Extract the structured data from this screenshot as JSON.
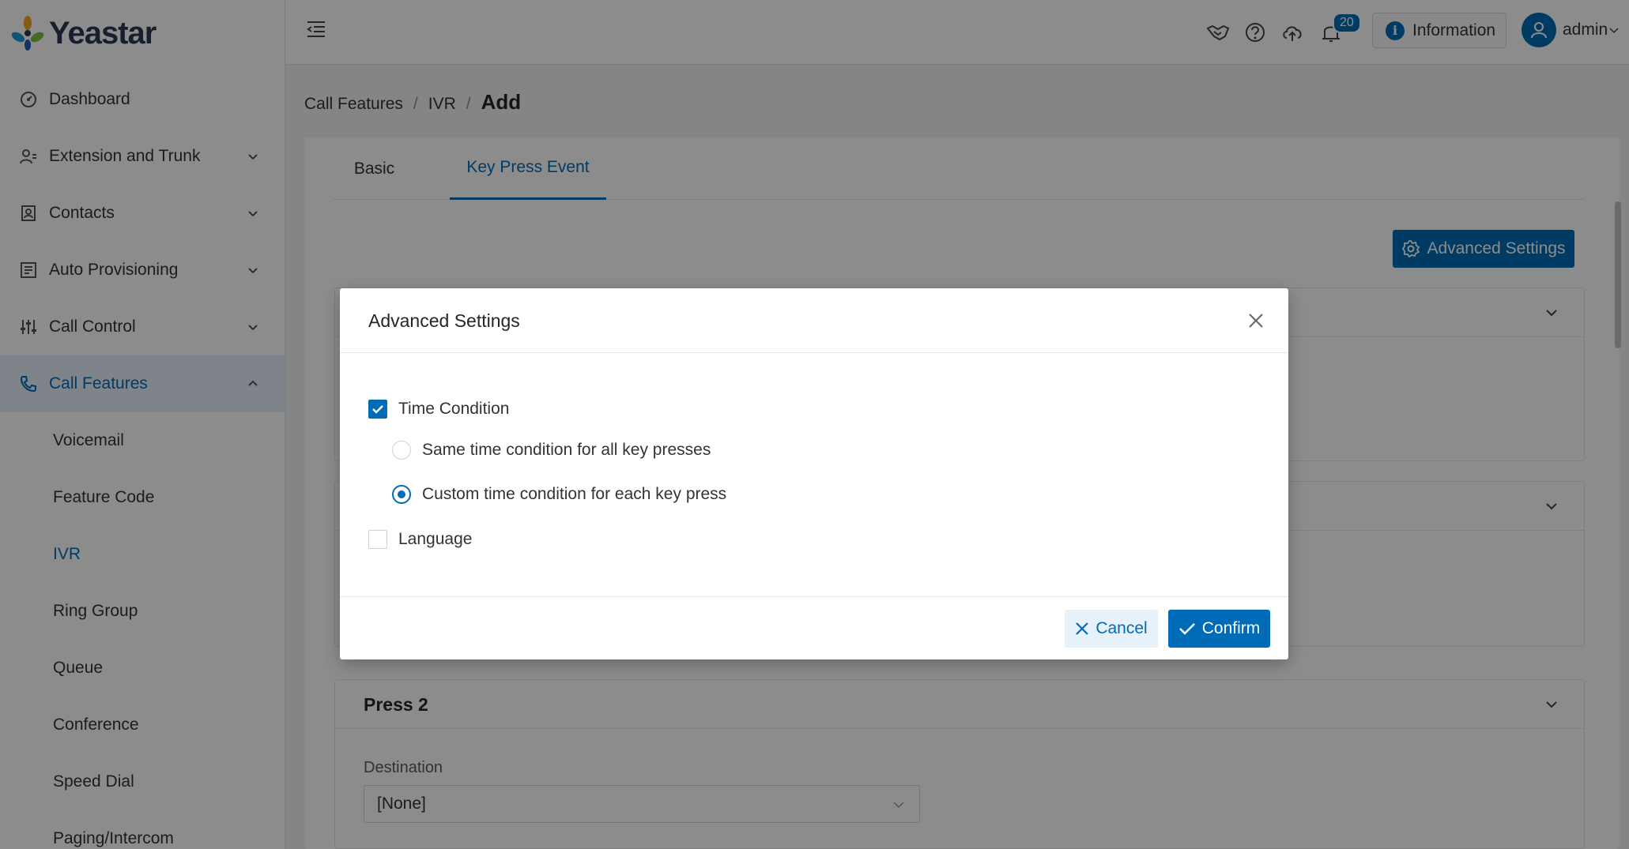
{
  "app": {
    "name": "Yeastar",
    "brand_color": "#006cb7"
  },
  "sidebar": {
    "items": [
      {
        "label": "Dashboard",
        "icon": "dashboard-icon"
      },
      {
        "label": "Extension and Trunk",
        "icon": "users-icon"
      },
      {
        "label": "Contacts",
        "icon": "contacts-icon"
      },
      {
        "label": "Auto Provisioning",
        "icon": "provisioning-icon"
      },
      {
        "label": "Call Control",
        "icon": "sliders-icon"
      },
      {
        "label": "Call Features",
        "icon": "phone-icon"
      }
    ],
    "sub_items": [
      "Voicemail",
      "Feature Code",
      "IVR",
      "Ring Group",
      "Queue",
      "Conference",
      "Speed Dial",
      "Paging/Intercom"
    ]
  },
  "header": {
    "notification_count": "20",
    "info_label": "Information",
    "user_name": "admin"
  },
  "breadcrumb": {
    "part1": "Call Features",
    "part2": "IVR",
    "current": "Add",
    "sep": "/"
  },
  "tabs": {
    "basic": "Basic",
    "key_press": "Key Press Event"
  },
  "main": {
    "advanced_button": "Advanced Settings",
    "press2_title": "Press 2",
    "destination_label": "Destination",
    "destination_value": "[None]"
  },
  "modal": {
    "title": "Advanced Settings",
    "time_condition": {
      "label": "Time Condition",
      "checked": true
    },
    "radio_same": {
      "label": "Same time condition for all key presses",
      "checked": false
    },
    "radio_custom": {
      "label": "Custom time condition for each key press",
      "checked": true
    },
    "language": {
      "label": "Language",
      "checked": false
    },
    "cancel": "Cancel",
    "confirm": "Confirm"
  }
}
